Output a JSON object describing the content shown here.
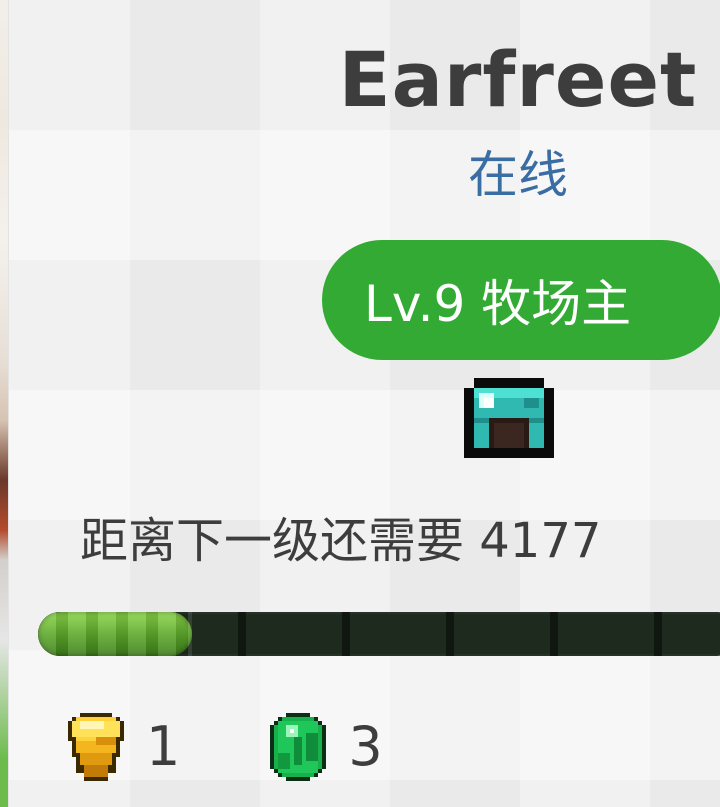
{
  "profile": {
    "username": "Earfreet",
    "status": "在线",
    "status_color": "#3a6da3",
    "level_badge": "Lv.9 牧场主",
    "badge_color": "#33aa33",
    "helmet_icon": "diamond-helmet-icon",
    "xp_message": "距离下一级还需要 4177",
    "xp_progress_fraction": 0.22,
    "currencies": [
      {
        "icon": "gold-ingot-icon",
        "count": "1"
      },
      {
        "icon": "emerald-icon",
        "count": "3"
      }
    ]
  }
}
